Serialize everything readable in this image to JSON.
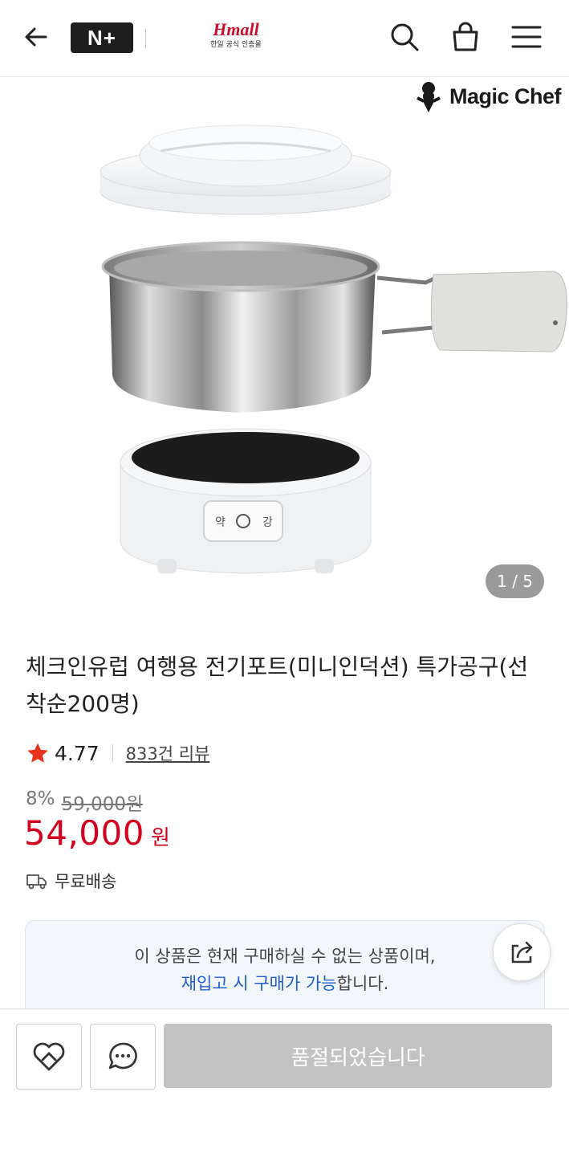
{
  "header": {
    "badge_label": "N+",
    "logo_text": "Hmall",
    "logo_sub": "한일 공식 인증몰"
  },
  "gallery": {
    "brand": "Magic Chef",
    "panel_left": "약",
    "panel_right": "강",
    "counter": "1 / 5"
  },
  "product": {
    "title": "체크인유럽 여행용 전기포트(미니인덕션) 특가공구(선착순200명)",
    "rating": "4.77",
    "review_link": "833건 리뷰",
    "discount": "8%",
    "original_price": "59,000원",
    "price": "54,000",
    "price_unit": "원",
    "shipping": "무료배송"
  },
  "notice": {
    "line1": "이 상품은 현재 구매하실 수 없는 상품이며,",
    "line2_link": "재입고 시 구매가 가능",
    "line2_tail": "합니다."
  },
  "bottom_bar": {
    "soldout_label": "품절되었습니다"
  },
  "colors": {
    "price_red": "#d2001e",
    "star": "#e8321c",
    "link_blue": "#1f5fc9",
    "disabled_gray": "#c2c2c2"
  },
  "icons": [
    "back-arrow-icon",
    "search-icon",
    "shopping-bag-icon",
    "menu-icon",
    "star-icon",
    "truck-icon",
    "share-icon",
    "heart-icon",
    "chat-icon"
  ]
}
